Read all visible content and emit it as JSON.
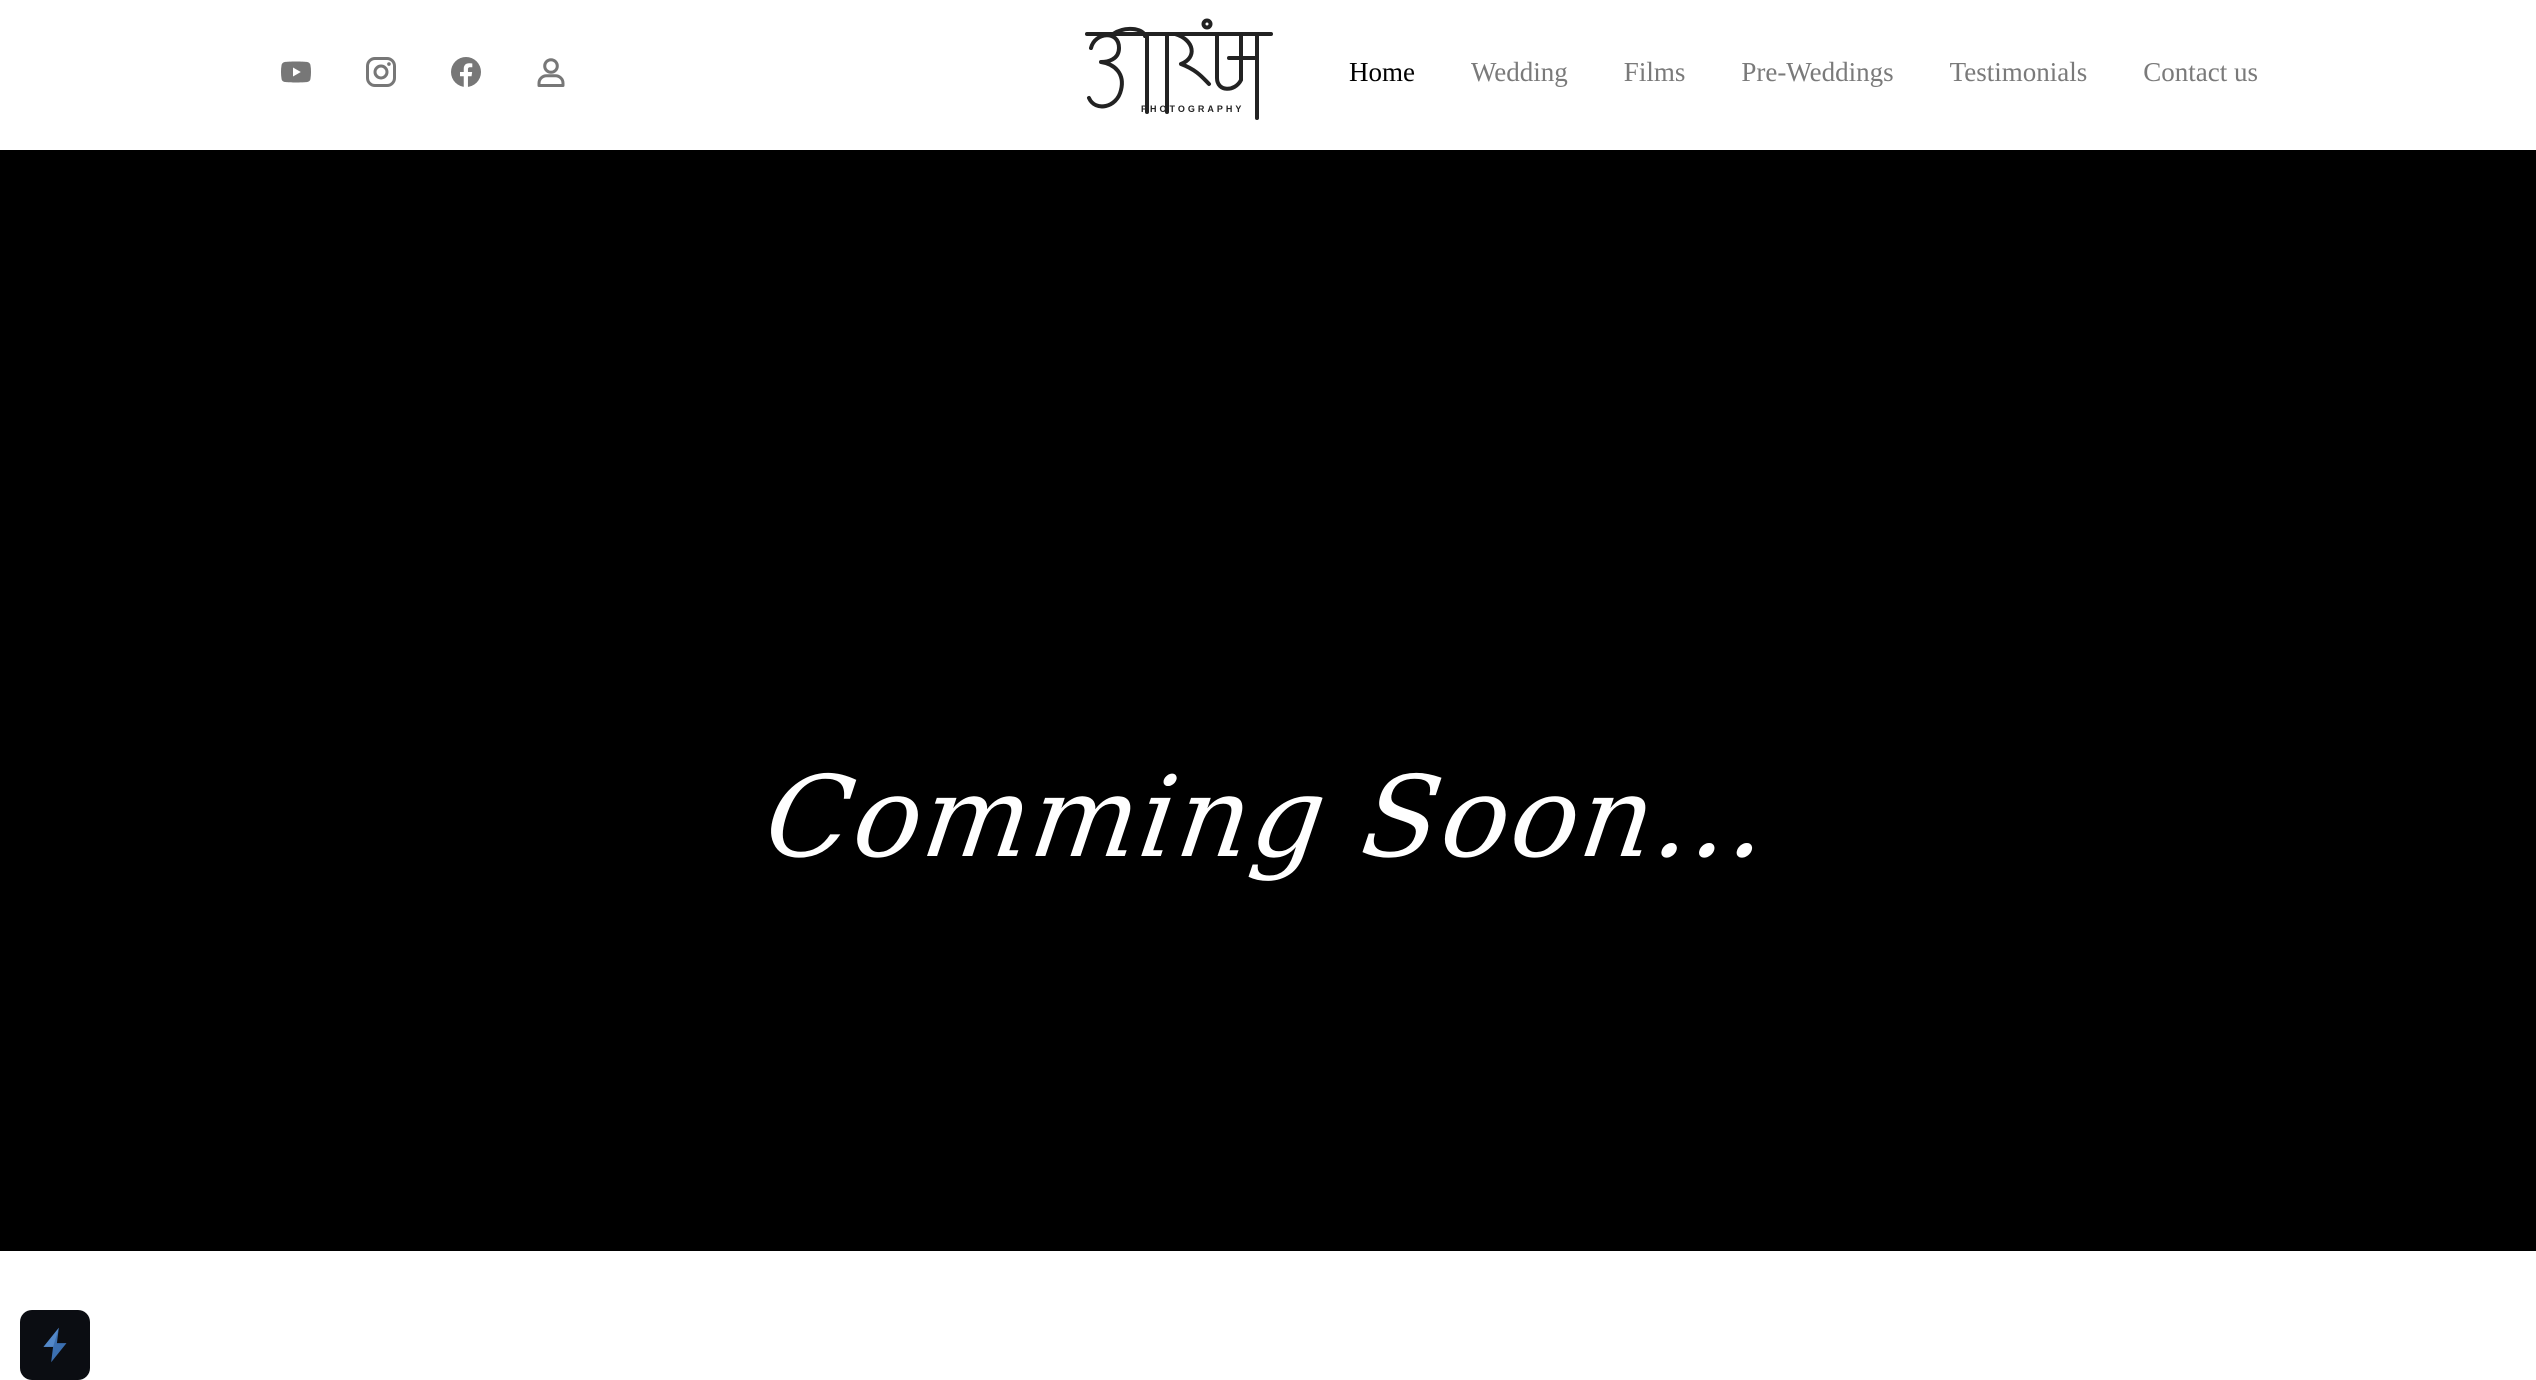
{
  "header": {
    "social": [
      {
        "name": "youtube-icon",
        "label": "YouTube"
      },
      {
        "name": "instagram-icon",
        "label": "Instagram"
      },
      {
        "name": "facebook-icon",
        "label": "Facebook"
      },
      {
        "name": "user-icon",
        "label": "Account"
      }
    ],
    "logo": {
      "text": "PHOTOGRAPHY"
    },
    "nav": [
      {
        "label": "Home",
        "active": true
      },
      {
        "label": "Wedding",
        "active": false
      },
      {
        "label": "Films",
        "active": false
      },
      {
        "label": "Pre-Weddings",
        "active": false
      },
      {
        "label": "Testimonials",
        "active": false
      },
      {
        "label": "Contact us",
        "active": false
      }
    ]
  },
  "hero": {
    "title": "Comming Soon..."
  },
  "colors": {
    "icon_gray": "#777777",
    "nav_gray": "#7a7a7a",
    "nav_active": "#000000",
    "hero_bg": "#000000",
    "hero_text": "#ffffff",
    "badge_accent": "#3b6fb0"
  }
}
